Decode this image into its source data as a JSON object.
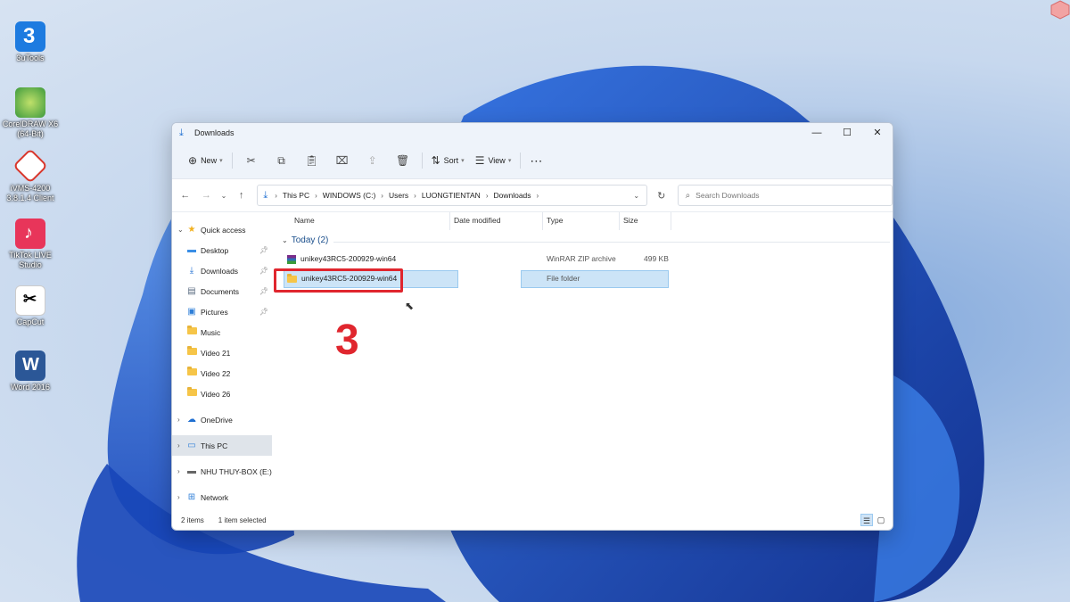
{
  "desktop": {
    "icons": [
      {
        "label": "3uTools",
        "color": "#1d7be0"
      },
      {
        "label": "CorelDRAW X6 (64-Bit)",
        "color": "#3d9a3d"
      },
      {
        "label": "iVMS-4200 3.8.1.4 Client",
        "color": "#d9362b"
      },
      {
        "label": "TikTok LIVE Studio",
        "color": "#e8355a"
      },
      {
        "label": "CapCut",
        "color": "#ffffff"
      },
      {
        "label": "Word 2016",
        "color": "#2b5797"
      }
    ]
  },
  "window": {
    "title": "Downloads",
    "title_icon": "download-icon",
    "controls": {
      "minimize": "—",
      "maximize": "☐",
      "close": "✕"
    }
  },
  "toolbar": {
    "new_label": "New",
    "sort_label": "Sort",
    "view_label": "View",
    "more_label": "⋯"
  },
  "address": {
    "crumbs": [
      "This PC",
      "WINDOWS (C:)",
      "Users",
      "LUONGTIENTAN",
      "Downloads"
    ],
    "search_placeholder": "Search Downloads"
  },
  "sidebar": {
    "items": [
      {
        "label": "Quick access",
        "icon": "star-icon"
      },
      {
        "label": "Desktop",
        "icon": "desktop-icon"
      },
      {
        "label": "Downloads",
        "icon": "download-icon"
      },
      {
        "label": "Documents",
        "icon": "documents-icon"
      },
      {
        "label": "Pictures",
        "icon": "pictures-icon"
      },
      {
        "label": "Music",
        "icon": "folder-icon"
      },
      {
        "label": "Video 21",
        "icon": "folder-icon"
      },
      {
        "label": "Video 22",
        "icon": "folder-icon"
      },
      {
        "label": "Video 26",
        "icon": "folder-icon"
      },
      {
        "label": "OneDrive",
        "icon": "cloud-icon"
      },
      {
        "label": "This PC",
        "icon": "pc-icon"
      },
      {
        "label": "NHU THUY-BOX (E:)",
        "icon": "drive-icon"
      },
      {
        "label": "Network",
        "icon": "network-icon"
      }
    ]
  },
  "columns": {
    "name": "Name",
    "date": "Date modified",
    "type": "Type",
    "size": "Size"
  },
  "group": {
    "label": "Today (2)"
  },
  "files": [
    {
      "name": "unikey43RC5-200929-win64",
      "type": "WinRAR ZIP archive",
      "size": "499 KB",
      "icon": "winrar-icon"
    },
    {
      "name": "unikey43RC5-200929-win64",
      "type": "File folder",
      "size": "",
      "icon": "folder-icon"
    }
  ],
  "annotation": {
    "step": "3"
  },
  "status": {
    "count": "2 items",
    "selected": "1 item selected"
  }
}
